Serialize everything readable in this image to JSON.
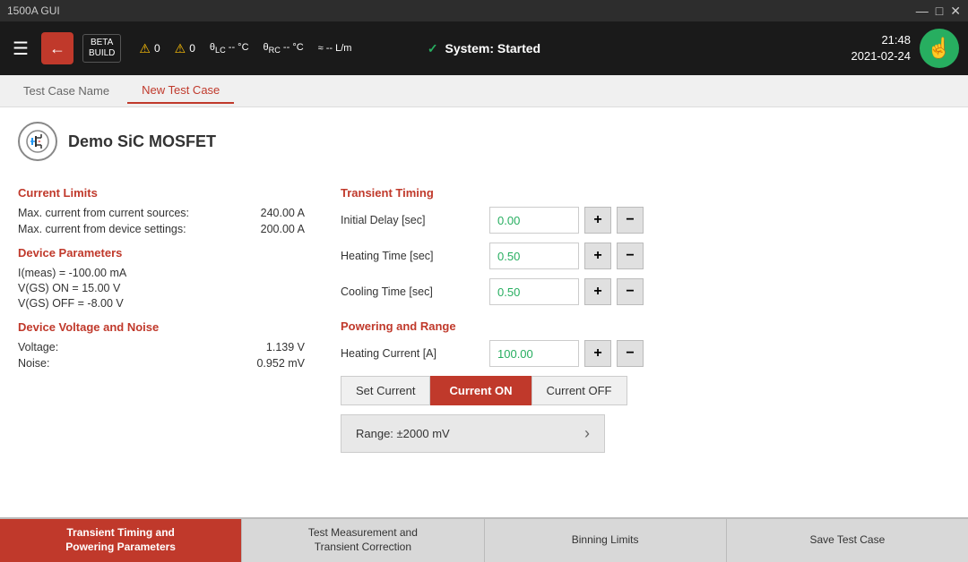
{
  "titleBar": {
    "title": "1500A GUI",
    "controls": [
      "—",
      "□",
      "✕"
    ]
  },
  "toolbar": {
    "betaBuild": "BETA\nBUILD",
    "indicators": [
      {
        "icon": "⚠",
        "value": "0"
      },
      {
        "icon": "⚠",
        "value": "0"
      },
      {
        "symbol": "θ_LC",
        "value": "-- °C"
      },
      {
        "symbol": "θ_RC",
        "value": "-- °C"
      },
      {
        "symbol": "≈",
        "value": "-- L/m"
      }
    ],
    "systemStatus": "✓ System: Started",
    "time": "21:48",
    "date": "2021-02-24"
  },
  "tabs": {
    "testCaseNameLabel": "Test Case Name",
    "newTestCaseLabel": "New Test Case"
  },
  "device": {
    "name": "Demo SiC MOSFET"
  },
  "currentLimits": {
    "title": "Current Limits",
    "maxCurrentSources": "Max. current from current sources:",
    "maxCurrentSourcesValue": "240.00 A",
    "maxCurrentDevice": "Max. current from device settings:",
    "maxCurrentDeviceValue": "200.00 A"
  },
  "deviceParameters": {
    "title": "Device Parameters",
    "lines": [
      "I(meas) = -100.00 mA",
      "V(GS) ON = 15.00 V",
      "V(GS) OFF = -8.00 V"
    ]
  },
  "deviceVoltageNoise": {
    "title": "Device Voltage and Noise",
    "voltageLabel": "Voltage:",
    "voltageValue": "1.139 V",
    "noiseLabel": "Noise:",
    "noiseValue": "0.952 mV"
  },
  "transientTiming": {
    "title": "Transient Timing",
    "initialDelayLabel": "Initial Delay [sec]",
    "initialDelayValue": "0.00",
    "heatingTimeLabel": "Heating Time [sec]",
    "heatingTimeValue": "0.50",
    "coolingTimeLabel": "Cooling Time [sec]",
    "coolingTimeValue": "0.50"
  },
  "poweringRange": {
    "title": "Powering and Range",
    "heatingCurrentLabel": "Heating Current [A]",
    "heatingCurrentValue": "100.00",
    "setCurrentLabel": "Set Current",
    "currentOnLabel": "Current ON",
    "currentOffLabel": "Current OFF",
    "rangeText": "Range: ±2000 mV"
  },
  "bottomTabs": [
    {
      "label": "Transient Timing and\nPowering Parameters",
      "active": true
    },
    {
      "label": "Test Measurement and\nTransient Correction",
      "active": false
    },
    {
      "label": "Binning Limits",
      "active": false
    },
    {
      "label": "Save Test Case",
      "active": false
    }
  ]
}
